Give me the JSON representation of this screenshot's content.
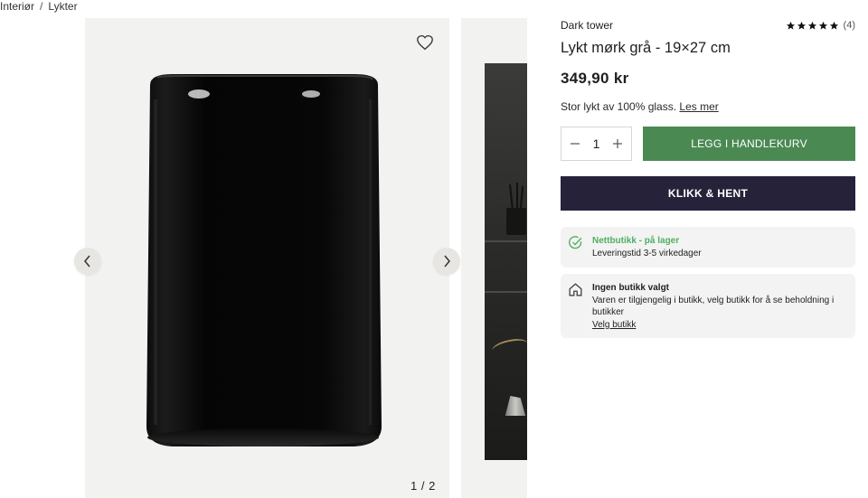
{
  "breadcrumb": {
    "items": [
      "Interiør",
      "Lykter"
    ],
    "separator": "/"
  },
  "gallery": {
    "counter": "1 / 2",
    "favorite_icon": "heart-outline-icon",
    "prev_icon": "chevron-left-icon",
    "next_icon": "chevron-right-icon"
  },
  "product": {
    "brand": "Dark tower",
    "rating_stars": 5,
    "rating_count": "(4)",
    "title": "Lykt mørk grå - 19×27 cm",
    "price": "349,90 kr",
    "description": "Stor lykt av 100% glass.",
    "read_more": "Les mer"
  },
  "purchase": {
    "quantity": "1",
    "minus_icon": "minus-icon",
    "plus_icon": "plus-icon",
    "add_to_cart_label": "LEGG I HANDLEKURV",
    "click_collect_label": "KLIKK & HENT"
  },
  "stock": {
    "icon": "check-circle-icon",
    "status": "Nettbutikk - på lager",
    "delivery": "Leveringstid 3-5 virkedager"
  },
  "store": {
    "icon": "house-icon",
    "title": "Ingen butikk valgt",
    "message": "Varen er tilgjengelig i butikk, velg butikk for å se beholdning i butikker",
    "link": "Velg butikk"
  },
  "colors": {
    "cart_button": "#4a8a52",
    "click_collect_button": "#26223a",
    "in_stock": "#4fae62",
    "gallery_bg": "#f2f2f0"
  }
}
